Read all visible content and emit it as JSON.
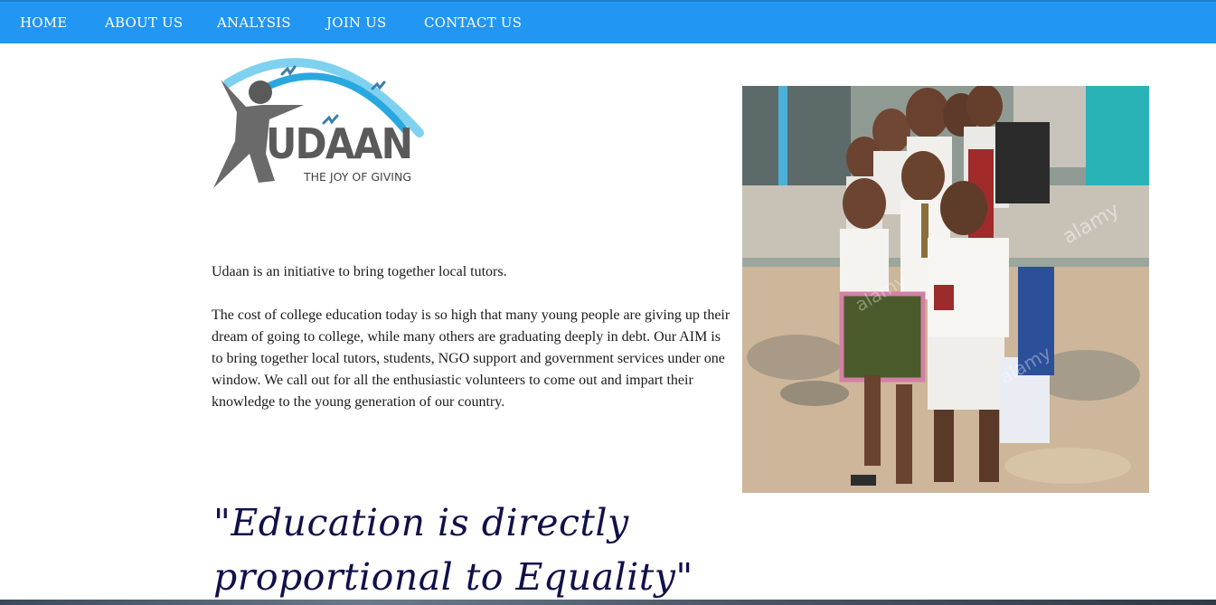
{
  "nav": {
    "items": [
      {
        "label": "HOME"
      },
      {
        "label": "ABOUT US"
      },
      {
        "label": "ANALYSIS"
      },
      {
        "label": "JOIN US"
      },
      {
        "label": "CONTACT US"
      }
    ]
  },
  "logo": {
    "word": "UDAAN",
    "tagline": "THE JOY OF GIVING"
  },
  "content": {
    "intro": "Udaan is an initiative to bring together local tutors.",
    "body": "The cost of college education today is so high that many young people are giving up their dream of going to college, while many others are graduating deeply in debt. Our AIM is to bring together local tutors, students, NGO support and government services under one window. We call out for all the enthusiastic volunteers to come out and impart their knowledge to the young generation of our country.",
    "quote": "\"Education is directly proportional to Equality\""
  },
  "photo": {
    "watermark": "alamy"
  },
  "colors": {
    "nav_bg": "#2196f3",
    "quote": "#10104a",
    "logo_arc": "#5bc0eb",
    "logo_figure": "#5a5a5a"
  }
}
